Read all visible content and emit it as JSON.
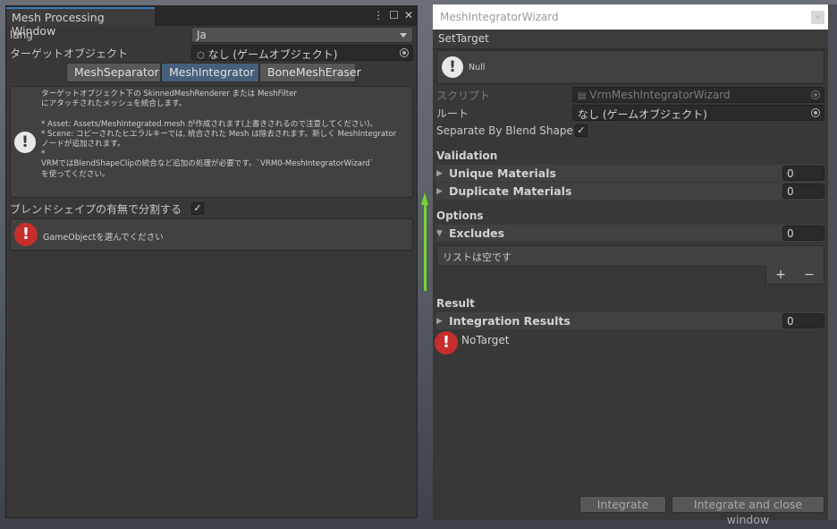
{
  "left_window": {
    "title": "Mesh Processing Window",
    "icons": [
      "menu-icon",
      "maximize-icon",
      "close-icon"
    ],
    "lang_label": "lang",
    "lang_value": "Ja",
    "target_label": "ターゲットオブジェクト",
    "target_value": "なし (ゲームオブジェクト)",
    "tabs": [
      "MeshSeparator",
      "MeshIntegrator",
      "BoneMeshEraser"
    ],
    "active_tab": "MeshIntegrator",
    "help_text": "ターゲットオブジェクト下の SkinnedMeshRenderer または MeshFilter\nにアタッチされたメッシュを統合します。\n\n* Asset: Assets/MeshIntegrated.mesh が作成されます(上書きされるので注意してください)。\n* Scene: コピーされたヒエラルキーでは, 統合された Mesh は除去されます。新しく MeshIntegrator\nノードが追加されます。\n*\nVRMではBlendShapeClipの統合など追加の処理が必要です。`VRM0-MeshIntegratorWizard`\nを使ってください。",
    "blendshape_label": "ブレンドシェイプの有無で分割する",
    "blendshape_checked": "✓",
    "error_text": "GameObjectを選んでください"
  },
  "right_window": {
    "title": "MeshIntegratorWizard",
    "section": "SetTarget",
    "null_text": "Null",
    "script_label": "スクリプト",
    "script_value": "VrmMeshIntegratorWizard",
    "root_label": "ルート",
    "root_value": "なし (ゲームオブジェクト)",
    "separate_label": "Separate By Blend Shape",
    "separate_checked": "✓",
    "validation_heading": "Validation",
    "unique_label": "Unique Materials",
    "unique_count": "0",
    "duplicate_label": "Duplicate Materials",
    "duplicate_count": "0",
    "options_heading": "Options",
    "excludes_label": "Excludes",
    "excludes_count": "0",
    "list_empty": "リストは空です",
    "add_symbol": "+",
    "remove_symbol": "−",
    "result_heading": "Result",
    "results_label": "Integration Results",
    "results_count": "0",
    "notarget_text": "NoTarget",
    "integrate_label": "Integrate",
    "integrate_close_label": "Integrate and close window"
  },
  "colors": {
    "panel": "#383838",
    "field": "#2a2a2a",
    "active_tab": "#46607c",
    "error_red": "#c62d2d",
    "title_accent": "#3a79bb"
  }
}
